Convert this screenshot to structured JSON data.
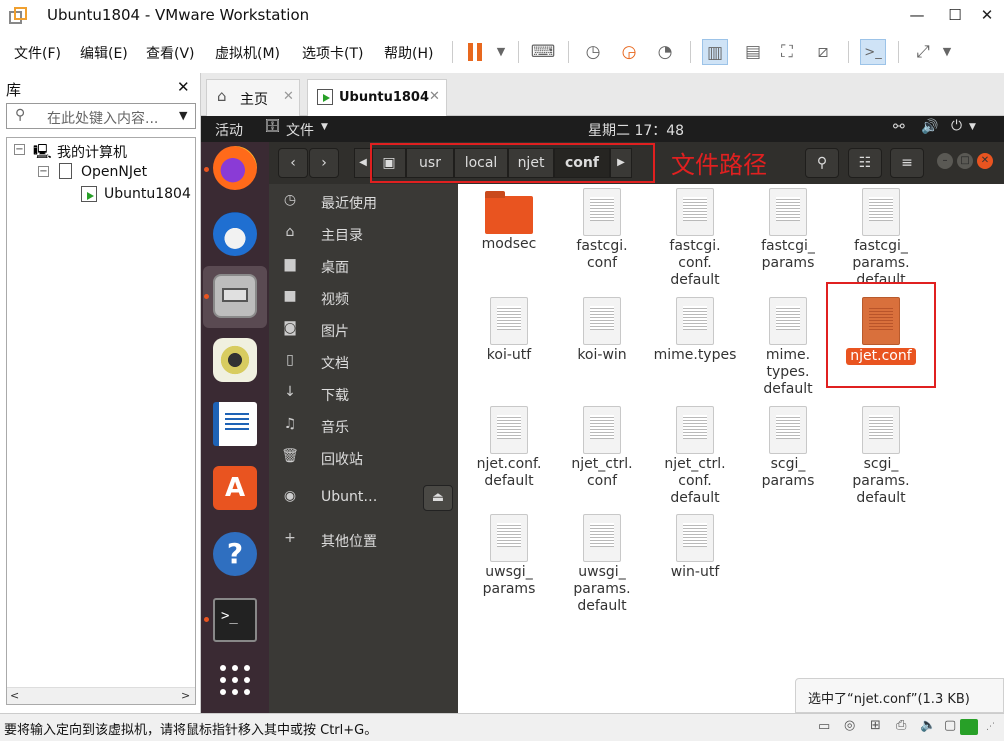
{
  "window": {
    "title": "Ubuntu1804 - VMware Workstation"
  },
  "menu": [
    "文件(F)",
    "编辑(E)",
    "查看(V)",
    "虚拟机(M)",
    "选项卡(T)",
    "帮助(H)"
  ],
  "library": {
    "title": "库",
    "search_placeholder": "在此处键入内容...",
    "tree": {
      "root": "我的计算机",
      "group": "OpenNJet",
      "vm": "Ubuntu1804"
    }
  },
  "vm_tabs": [
    {
      "label": "主页"
    },
    {
      "label": "Ubuntu1804"
    }
  ],
  "ubuntu_bar": {
    "activities": "活动",
    "app_menu": "文件",
    "clock": "星期二 17：48"
  },
  "path": {
    "crumbs": [
      "usr",
      "local",
      "njet",
      "conf"
    ],
    "annotation": "文件路径"
  },
  "sidebar": [
    {
      "icon": "clock-icon",
      "label": "最近使用"
    },
    {
      "icon": "home-icon",
      "label": "主目录"
    },
    {
      "icon": "folder-icon",
      "label": "桌面"
    },
    {
      "icon": "video-icon",
      "label": "视频"
    },
    {
      "icon": "camera-icon",
      "label": "图片"
    },
    {
      "icon": "document-icon",
      "label": "文档"
    },
    {
      "icon": "download-icon",
      "label": "下载"
    },
    {
      "icon": "music-icon",
      "label": "音乐"
    },
    {
      "icon": "trash-icon",
      "label": "回收站"
    },
    {
      "icon": "disc-icon",
      "label": "Ubunt…"
    },
    {
      "icon": "plus-icon",
      "label": "其他位置"
    }
  ],
  "files": [
    {
      "name": "modsec",
      "type": "folder"
    },
    {
      "name": "fastcgi.\nconf",
      "type": "file"
    },
    {
      "name": "fastcgi.\nconf.\ndefault",
      "type": "file"
    },
    {
      "name": "fastcgi_\nparams",
      "type": "file"
    },
    {
      "name": "fastcgi_\nparams.\ndefault",
      "type": "file"
    },
    {
      "name": "koi-utf",
      "type": "file"
    },
    {
      "name": "koi-win",
      "type": "file"
    },
    {
      "name": "mime.types",
      "type": "file"
    },
    {
      "name": "mime.\ntypes.\ndefault",
      "type": "file"
    },
    {
      "name": "njet.conf",
      "type": "file",
      "selected": true
    },
    {
      "name": "njet.conf.\ndefault",
      "type": "file"
    },
    {
      "name": "njet_ctrl.\nconf",
      "type": "file"
    },
    {
      "name": "njet_ctrl.\nconf.\ndefault",
      "type": "file"
    },
    {
      "name": "scgi_\nparams",
      "type": "file"
    },
    {
      "name": "scgi_\nparams.\ndefault",
      "type": "file"
    },
    {
      "name": "uwsgi_\nparams",
      "type": "file"
    },
    {
      "name": "uwsgi_\nparams.\ndefault",
      "type": "file"
    },
    {
      "name": "win-utf",
      "type": "file"
    }
  ],
  "selection_status": "选中了“njet.conf”(1.3 KB)",
  "statusbar": {
    "text": "要将输入定向到该虚拟机，请将鼠标指针移入其中或按 Ctrl+G。"
  },
  "colors": {
    "ubuntu_orange": "#e95420",
    "annotation_red": "#e02020",
    "dock": "#3a2a33"
  }
}
